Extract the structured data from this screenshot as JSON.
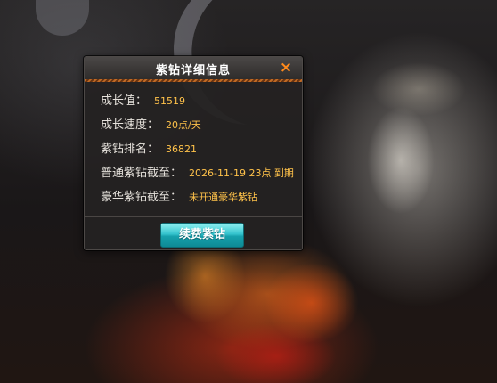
{
  "dialog": {
    "title": "紫钻详细信息",
    "close_icon": "×",
    "rows": [
      {
        "label": "成长值：",
        "value": "51519"
      },
      {
        "label": "成长速度：",
        "value": "20点/天"
      },
      {
        "label": "紫钻排名：",
        "value": "36821"
      },
      {
        "label": "普通紫钻截至：",
        "value": "2026-11-19 23点 到期"
      },
      {
        "label": "豪华紫钻截至：",
        "value": "未开通豪华紫钻"
      }
    ],
    "renew_button": "续费紫钻"
  },
  "colors": {
    "value_text": "#ffc24a",
    "close_icon": "#ff8a1c",
    "header_accent": "#a3561f",
    "button_teal": "#16a1ad"
  },
  "icons": {
    "close": "close-icon"
  }
}
